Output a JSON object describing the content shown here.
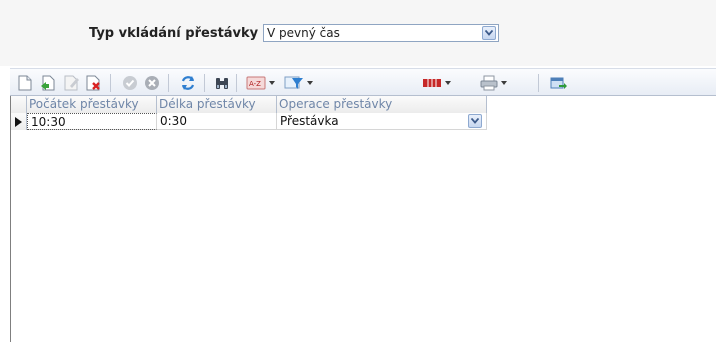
{
  "filter": {
    "label": "Typ vkládání přestávky",
    "selected": "V pevný čas"
  },
  "toolbar": {
    "icons": [
      "new-record-icon",
      "copy-record-icon",
      "edit-record-icon",
      "delete-record-icon",
      "confirm-icon",
      "cancel-icon",
      "refresh-icon",
      "find-icon",
      "sort-icon",
      "filter-icon",
      "columns-icon",
      "print-icon",
      "export-icon"
    ]
  },
  "grid": {
    "columns": [
      "Počátek přestávky",
      "Délka přestávky",
      "Operace přestávky"
    ],
    "rows": [
      {
        "start": "10:30",
        "length": "0:30",
        "operation": "Přestávka"
      }
    ]
  }
}
